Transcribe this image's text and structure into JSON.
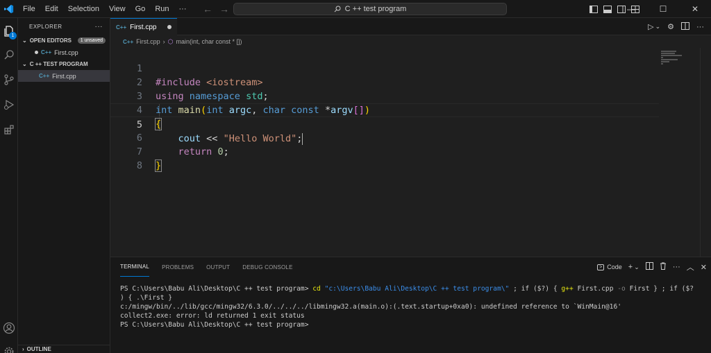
{
  "menu": [
    "File",
    "Edit",
    "Selection",
    "View",
    "Go",
    "Run",
    "···"
  ],
  "command_center": {
    "text": "C ++ test program"
  },
  "sidebar": {
    "title": "EXPLORER",
    "open_editors": {
      "label": "OPEN EDITORS",
      "badge": "1 unsaved",
      "file": "First.cpp"
    },
    "folder": {
      "label": "C ++ TEST PROGRAM",
      "file": "First.cpp"
    },
    "outline": "OUTLINE",
    "badge_count": "1"
  },
  "editor": {
    "tab_label": "First.cpp",
    "breadcrumb_file": "First.cpp",
    "breadcrumb_symbol": "main(int, char const * [])",
    "line_numbers": [
      "1",
      "2",
      "3",
      "4",
      "5",
      "6",
      "7",
      "8"
    ]
  },
  "panel": {
    "tabs": [
      "TERMINAL",
      "PROBLEMS",
      "OUTPUT",
      "DEBUG CONSOLE"
    ],
    "terminal_profile": "Code",
    "terminal": {
      "prompt": "PS C:\\Users\\Babu Ali\\Desktop\\C ++ test program>",
      "cmd_cd": "cd",
      "cmd_path": "\"c:\\Users\\Babu Ali\\Desktop\\C ++ test program\\\"",
      "cmd_rest1": " ; if ($?) {",
      "cmd_gpp": "g++",
      "cmd_gpp_args": " First.cpp",
      "cmd_o": " -o",
      "cmd_rest2": " First } ; if ($?",
      "line2": ") { .\\First }",
      "error_line": "c:/mingw/bin/../lib/gcc/mingw32/6.3.0/../../../libmingw32.a(main.o):(.text.startup+0xa0): undefined reference to `WinMain@16'",
      "collect_line": "collect2.exe: error: ld returned 1 exit status",
      "final_prompt": "PS C:\\Users\\Babu Ali\\Desktop\\C ++ test program>"
    }
  },
  "colors": {
    "accent": "#0078d4",
    "background": "#1f1f1f",
    "sidebar": "#181818"
  }
}
